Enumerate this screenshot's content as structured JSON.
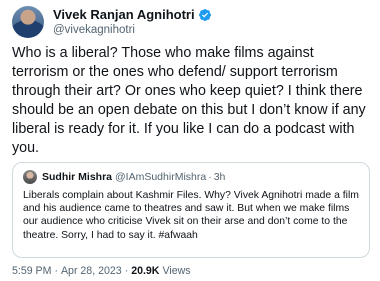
{
  "author": {
    "display_name": "Vivek Ranjan Agnihotri",
    "handle": "@vivekagnihotri",
    "verified_color": "#1d9bf0"
  },
  "tweet": {
    "text": "Who is a liberal? Those who make films against terrorism or the ones who defend/ support terrorism through their art? Or ones who keep quiet? I think there should be an open debate on this but I don’t know if any liberal is ready for it. If you like I can do a podcast with you."
  },
  "quoted_tweet": {
    "display_name": "Sudhir Mishra",
    "handle": "@IAmSudhirMishra",
    "separator": "·",
    "time": "3h",
    "text": "Liberals complain about Kashmir Files. Why? Vivek Agnihotri made a film and his audience came to theatres and saw it. But when we make films our audience who criticise Vivek sit on their arse and don’t come to the theatre. Sorry, I had to say it. #afwaah"
  },
  "meta": {
    "time": "5:59 PM",
    "dot1": "·",
    "date": "Apr 28, 2023",
    "dot2": "·",
    "views_count": "20.9K",
    "views_label": "Views"
  }
}
